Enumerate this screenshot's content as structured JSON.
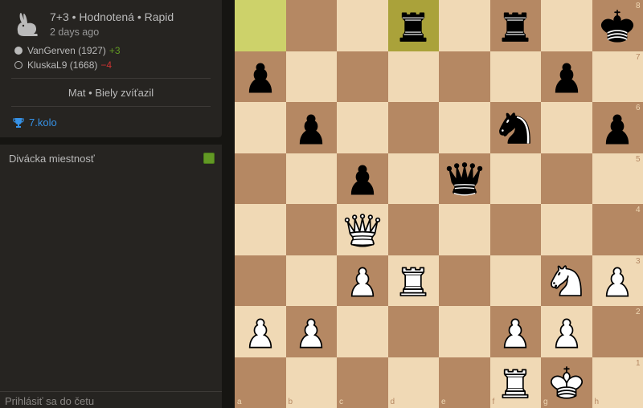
{
  "game": {
    "type": "7+3 • Hodnotená • Rapid",
    "date": "2 days ago",
    "white_player": {
      "name": "VanGerven (1927)",
      "diff": "+3"
    },
    "black_player": {
      "name": "KluskaL9 (1668)",
      "diff": "−4"
    },
    "result": "Mat • Biely zvíťazil",
    "tournament_round": "7.kolo"
  },
  "chat": {
    "title": "Divácka miestnosť",
    "placeholder": "Prihlásiť sa do četu"
  },
  "board": {
    "files": [
      "a",
      "b",
      "c",
      "d",
      "e",
      "f",
      "g",
      "h"
    ],
    "ranks": [
      "8",
      "7",
      "6",
      "5",
      "4",
      "3",
      "2",
      "1"
    ],
    "last_move": [
      "a8",
      "d8"
    ],
    "pieces": [
      {
        "sq": "d8",
        "type": "rook",
        "color": "black"
      },
      {
        "sq": "f8",
        "type": "rook",
        "color": "black"
      },
      {
        "sq": "h8",
        "type": "king",
        "color": "black"
      },
      {
        "sq": "a7",
        "type": "pawn",
        "color": "black"
      },
      {
        "sq": "g7",
        "type": "pawn",
        "color": "black"
      },
      {
        "sq": "b6",
        "type": "pawn",
        "color": "black"
      },
      {
        "sq": "f6",
        "type": "knight",
        "color": "black"
      },
      {
        "sq": "h6",
        "type": "pawn",
        "color": "black"
      },
      {
        "sq": "c5",
        "type": "pawn",
        "color": "black"
      },
      {
        "sq": "e5",
        "type": "queen",
        "color": "black"
      },
      {
        "sq": "c4",
        "type": "queen",
        "color": "white"
      },
      {
        "sq": "c3",
        "type": "pawn",
        "color": "white"
      },
      {
        "sq": "d3",
        "type": "rook",
        "color": "white"
      },
      {
        "sq": "g3",
        "type": "knight",
        "color": "white"
      },
      {
        "sq": "h3",
        "type": "pawn",
        "color": "white"
      },
      {
        "sq": "a2",
        "type": "pawn",
        "color": "white"
      },
      {
        "sq": "b2",
        "type": "pawn",
        "color": "white"
      },
      {
        "sq": "f2",
        "type": "pawn",
        "color": "white"
      },
      {
        "sq": "g2",
        "type": "pawn",
        "color": "white"
      },
      {
        "sq": "f1",
        "type": "rook",
        "color": "white"
      },
      {
        "sq": "g1",
        "type": "king",
        "color": "white"
      }
    ]
  },
  "colors": {
    "light_square": "#f0d9b5",
    "dark_square": "#b58863",
    "highlight_light": "#cdd26a",
    "highlight_dark": "#aaa23a",
    "link": "#3692e7",
    "positive": "#629924",
    "negative": "#cc3333"
  }
}
